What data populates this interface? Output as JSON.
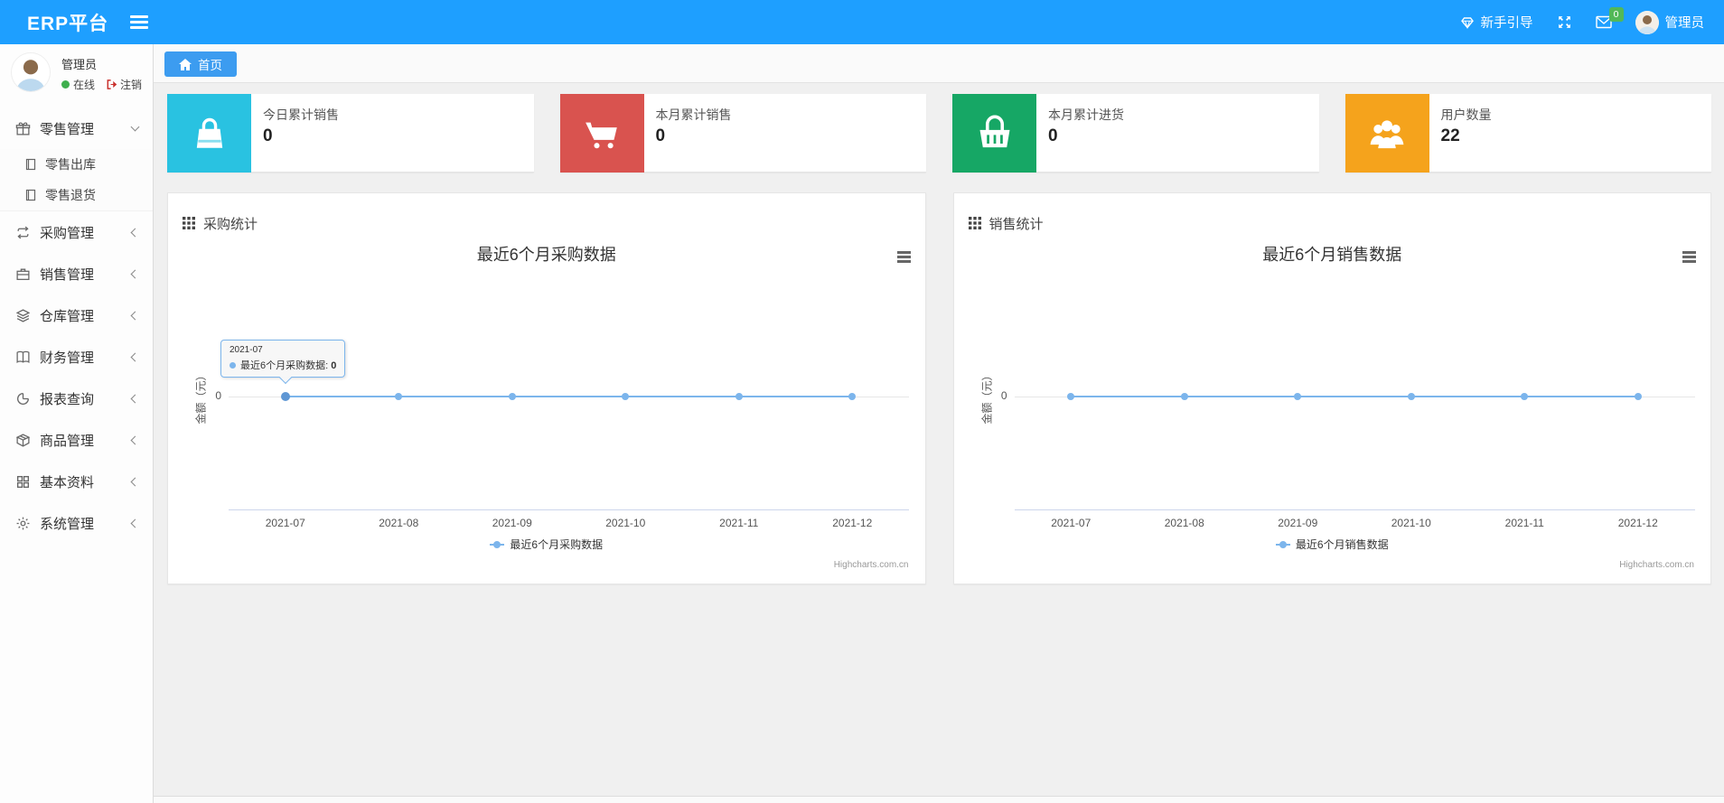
{
  "colors": {
    "navbar": "#1e9fff",
    "home_tab": "#3c9cf0",
    "badge": "#52b858",
    "line": "#7cb5ec"
  },
  "navbar": {
    "brand": "ERP平台",
    "guide_label": "新手引导",
    "message_badge": "0",
    "username": "管理员"
  },
  "sidebar": {
    "user": {
      "name": "管理员",
      "status_label": "在线",
      "logout_label": "注销"
    },
    "menu": [
      {
        "label": "零售管理",
        "icon": "gift-icon",
        "expanded": true,
        "children": [
          {
            "label": "零售出库",
            "icon": "document-icon"
          },
          {
            "label": "零售退货",
            "icon": "document-icon"
          }
        ]
      },
      {
        "label": "采购管理",
        "icon": "repeat-icon"
      },
      {
        "label": "销售管理",
        "icon": "briefcase-icon"
      },
      {
        "label": "仓库管理",
        "icon": "layers-icon"
      },
      {
        "label": "财务管理",
        "icon": "book-icon"
      },
      {
        "label": "报表查询",
        "icon": "pie-chart-icon"
      },
      {
        "label": "商品管理",
        "icon": "box-icon"
      },
      {
        "label": "基本资料",
        "icon": "grid-icon"
      },
      {
        "label": "系统管理",
        "icon": "gear-icon"
      }
    ]
  },
  "breadcrumb": {
    "home": "首页"
  },
  "stat_cards": [
    {
      "title": "今日累计销售",
      "value": "0",
      "color": "#29c2e1",
      "icon": "shopping-bag-icon"
    },
    {
      "title": "本月累计销售",
      "value": "0",
      "color": "#d9534f",
      "icon": "shopping-cart-icon"
    },
    {
      "title": "本月累计进货",
      "value": "0",
      "color": "#16a765",
      "icon": "shopping-basket-icon"
    },
    {
      "title": "用户数量",
      "value": "22",
      "color": "#f5a31c",
      "icon": "users-icon"
    }
  ],
  "panels": [
    {
      "title": "采购统计"
    },
    {
      "title": "销售统计"
    }
  ],
  "chart_data": [
    {
      "type": "line",
      "title": "最近6个月采购数据",
      "categories": [
        "2021-07",
        "2021-08",
        "2021-09",
        "2021-10",
        "2021-11",
        "2021-12"
      ],
      "series": [
        {
          "name": "最近6个月采购数据",
          "values": [
            0,
            0,
            0,
            0,
            0,
            0
          ]
        }
      ],
      "xlabel": "",
      "ylabel": "金额（元）",
      "yticks": [
        "0"
      ],
      "grid": true,
      "legend_position": "bottom",
      "line_color": "#7cb5ec",
      "credits": "Highcharts.com.cn",
      "tooltip": {
        "category": "2021-07",
        "series": "最近6个月采购数据",
        "value": "0"
      }
    },
    {
      "type": "line",
      "title": "最近6个月销售数据",
      "categories": [
        "2021-07",
        "2021-08",
        "2021-09",
        "2021-10",
        "2021-11",
        "2021-12"
      ],
      "series": [
        {
          "name": "最近6个月销售数据",
          "values": [
            0,
            0,
            0,
            0,
            0,
            0
          ]
        }
      ],
      "xlabel": "",
      "ylabel": "金额（元）",
      "yticks": [
        "0"
      ],
      "grid": true,
      "legend_position": "bottom",
      "line_color": "#7cb5ec",
      "credits": "Highcharts.com.cn",
      "tooltip": null
    }
  ]
}
